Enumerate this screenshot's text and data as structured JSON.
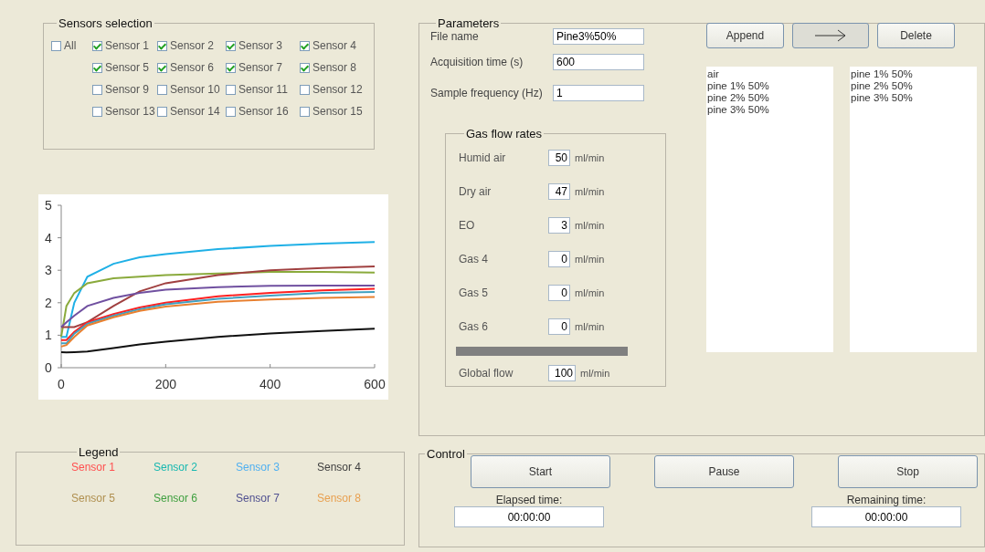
{
  "sensors_selection": {
    "title": "Sensors selection",
    "all": {
      "label": "All",
      "checked": false
    },
    "items": [
      {
        "label": "Sensor 1",
        "checked": true
      },
      {
        "label": "Sensor 2",
        "checked": true
      },
      {
        "label": "Sensor 3",
        "checked": true
      },
      {
        "label": "Sensor 4",
        "checked": true
      },
      {
        "label": "Sensor 5",
        "checked": true
      },
      {
        "label": "Sensor 6",
        "checked": true
      },
      {
        "label": "Sensor 7",
        "checked": true
      },
      {
        "label": "Sensor 8",
        "checked": true
      },
      {
        "label": "Sensor 9",
        "checked": false
      },
      {
        "label": "Sensor 10",
        "checked": false
      },
      {
        "label": "Sensor 11",
        "checked": false
      },
      {
        "label": "Sensor 12",
        "checked": false
      },
      {
        "label": "Sensor 13",
        "checked": false
      },
      {
        "label": "Sensor 14",
        "checked": false
      },
      {
        "label": "Sensor 16",
        "checked": false
      },
      {
        "label": "Sensor 15",
        "checked": false
      }
    ]
  },
  "chart": {
    "chart_data": {
      "type": "line",
      "x": [
        0,
        10,
        25,
        50,
        100,
        150,
        200,
        300,
        400,
        500,
        600
      ],
      "xlim": [
        0,
        600
      ],
      "ylim": [
        0,
        5
      ],
      "xticks": [
        0,
        200,
        400,
        600
      ],
      "yticks": [
        0,
        1,
        2,
        3,
        4,
        5
      ],
      "series": [
        {
          "color": "#1fb0e6",
          "values": [
            0.95,
            0.95,
            2.0,
            2.8,
            3.2,
            3.4,
            3.5,
            3.65,
            3.75,
            3.82,
            3.87
          ]
        },
        {
          "color": "#8aaa3c",
          "values": [
            0.95,
            1.9,
            2.3,
            2.6,
            2.75,
            2.8,
            2.85,
            2.9,
            2.95,
            2.95,
            2.93
          ]
        },
        {
          "color": "#a04040",
          "values": [
            1.25,
            1.25,
            1.25,
            1.4,
            1.9,
            2.35,
            2.6,
            2.85,
            3.0,
            3.07,
            3.12
          ]
        },
        {
          "color": "#7050a0",
          "values": [
            1.25,
            1.4,
            1.6,
            1.9,
            2.15,
            2.3,
            2.4,
            2.48,
            2.52,
            2.53,
            2.53
          ]
        },
        {
          "color": "#ff2020",
          "values": [
            0.85,
            0.85,
            1.1,
            1.4,
            1.65,
            1.85,
            2.0,
            2.2,
            2.3,
            2.38,
            2.43
          ]
        },
        {
          "color": "#40a0c0",
          "values": [
            0.75,
            0.75,
            1.05,
            1.35,
            1.6,
            1.8,
            1.95,
            2.12,
            2.22,
            2.3,
            2.33
          ]
        },
        {
          "color": "#e88030",
          "values": [
            0.65,
            0.7,
            0.95,
            1.3,
            1.55,
            1.75,
            1.88,
            2.03,
            2.1,
            2.15,
            2.18
          ]
        },
        {
          "color": "#101010",
          "values": [
            0.48,
            0.47,
            0.48,
            0.5,
            0.6,
            0.72,
            0.8,
            0.95,
            1.05,
            1.13,
            1.2
          ]
        }
      ]
    }
  },
  "legend": {
    "title": "Legend",
    "items": [
      {
        "label": "Sensor 1",
        "color": "#ff5050"
      },
      {
        "label": "Sensor 2",
        "color": "#18b8b0"
      },
      {
        "label": "Sensor 3",
        "color": "#50b0f0"
      },
      {
        "label": "Sensor 4",
        "color": "#404040"
      },
      {
        "label": "Sensor 5",
        "color": "#b09050"
      },
      {
        "label": "Sensor 6",
        "color": "#40a040"
      },
      {
        "label": "Sensor 7",
        "color": "#505090"
      },
      {
        "label": "Sensor 8",
        "color": "#e8a050"
      }
    ]
  },
  "parameters": {
    "title": "Parameters",
    "fields": [
      {
        "label": "File name",
        "value": "Pine3%50%"
      },
      {
        "label": "Acquisition time (s)",
        "value": "600"
      },
      {
        "label": "Sample frequency (Hz)",
        "value": "1"
      }
    ],
    "buttons": [
      {
        "kind": "text",
        "label": "Append"
      },
      {
        "kind": "arrow"
      },
      {
        "kind": "text",
        "label": "Delete"
      }
    ],
    "list_left": [
      "air",
      "pine 1% 50%",
      "pine 2% 50%",
      "pine 3% 50%"
    ],
    "list_right": [
      "pine 1% 50%",
      "pine 2% 50%",
      "pine 3% 50%"
    ],
    "gas_flow_rates": {
      "title": "Gas flow rates",
      "rows": [
        {
          "label": "Humid air",
          "value": "50",
          "unit": "ml/min"
        },
        {
          "label": "Dry air",
          "value": "47",
          "unit": "ml/min"
        },
        {
          "label": "EO",
          "value": "3",
          "unit": "ml/min"
        },
        {
          "label": "Gas 4",
          "value": "0",
          "unit": "ml/min"
        },
        {
          "label": "Gas 5",
          "value": "0",
          "unit": "ml/min"
        },
        {
          "label": "Gas 6",
          "value": "0",
          "unit": "ml/min"
        }
      ],
      "global": {
        "label": "Global flow",
        "value": "100",
        "unit": "ml/min"
      }
    }
  },
  "control": {
    "title": "Control",
    "buttons": [
      "Start",
      "Pause",
      "Stop"
    ],
    "elapsed": {
      "label": "Elapsed time:",
      "value": "00:00:00"
    },
    "remaining": {
      "label": "Remaining time:",
      "value": "00:00:00"
    }
  }
}
